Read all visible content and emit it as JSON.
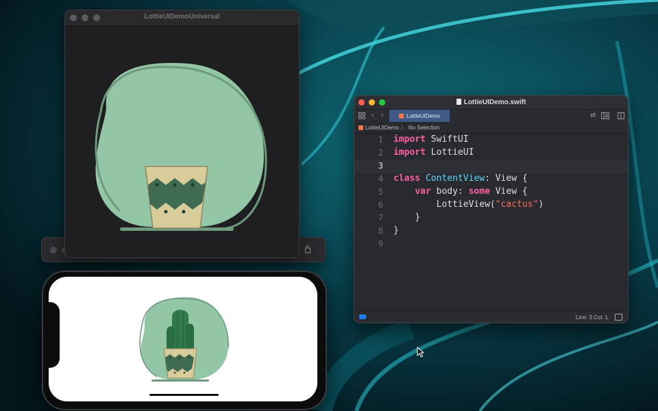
{
  "colors": {
    "wallpaper_base": "#062a33",
    "wallpaper_glow": "#1fd0e0",
    "blob_fill": "#93c6a4",
    "blob_stroke": "#6f9a7d",
    "pot_fill": "#d8cc9b",
    "pot_band": "#3f6b52",
    "cactus": "#2f7a4a",
    "xcode_tab": "#3f5a86",
    "keyword": "#fc5fa3",
    "type": "#5dd8ff",
    "string": "#fc6a5d"
  },
  "demo_window": {
    "title": "LottieUIDemoUniversal",
    "animation_name": "cactus"
  },
  "xcode": {
    "title": "LottieUIDemo.swift",
    "tab_label": "LottieUIDemo",
    "breadcrumb_project": "LottieUIDemo",
    "breadcrumb_separator": "〉",
    "breadcrumb_selection": "No Selection",
    "current_line": 3,
    "lines": [
      {
        "n": "1"
      },
      {
        "n": "2"
      },
      {
        "n": "3"
      },
      {
        "n": "4"
      },
      {
        "n": "5"
      },
      {
        "n": "6"
      },
      {
        "n": "7"
      },
      {
        "n": "8"
      },
      {
        "n": "9"
      }
    ],
    "code": {
      "l1_kw": "import",
      "l1_rest": " SwiftUI",
      "l2_kw": "import",
      "l2_rest": " LottieUI",
      "l4_kw": "class",
      "l4_type": "ContentView",
      "l4_rest": ": View {",
      "l5_indent": "    ",
      "l5_kw": "var",
      "l5_mid": " body: ",
      "l5_kw2": "some",
      "l5_rest": " View {",
      "l6_indent": "        ",
      "l6_fn": "LottieView(",
      "l6_str": "\"cactus\"",
      "l6_rest": ")",
      "l7": "    }",
      "l8": "}"
    },
    "status": "Line: 3  Col: 1"
  },
  "icons": {
    "grid": "grid-icon",
    "back": "chevron-left-icon",
    "forward": "chevron-right-icon",
    "related": "arrows-icon",
    "inspector": "inspector-icon",
    "split": "split-editor-icon",
    "rotate": "rotate-icon",
    "swift": "swift-icon",
    "cursor": "arrow-cursor-icon"
  }
}
